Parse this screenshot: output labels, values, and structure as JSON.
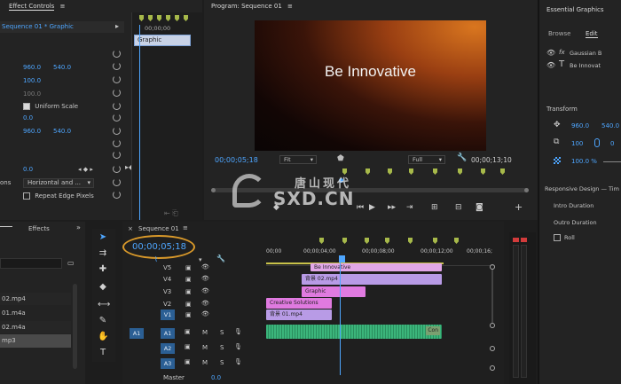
{
  "effect_controls": {
    "tab": "Effect Controls",
    "source": "Sequence 01 * Graphic",
    "clip_label": "Graphic",
    "timecode": "00;00;00",
    "pos_x": "960.0",
    "pos_y": "540.0",
    "scale": "100.0",
    "scale_width": "100.0",
    "uniform_scale": "Uniform Scale",
    "rotation": "0.0",
    "anchor_x": "960.0",
    "anchor_y": "540.0",
    "opacity": "0.0",
    "edge_label": "ons",
    "edge_value": "Horizontal and ...",
    "repeat_edge": "Repeat Edge Pixels"
  },
  "program": {
    "title": "Program: Sequence 01",
    "video_text": "Be Innovative",
    "timecode": "00;00;05;18",
    "fit": "Fit",
    "quality": "Full",
    "duration": "00;00;13;10"
  },
  "watermark": {
    "cn": "唐山现代",
    "domain": "SXD.CN"
  },
  "essential_graphics": {
    "title": "Essential Graphics",
    "tab_browse": "Browse",
    "tab_edit": "Edit",
    "layer1": "Gaussian B",
    "layer2": "Be Innovat",
    "transform": "Transform",
    "pos_x": "960.0",
    "pos_y": "540.0",
    "scale": "100",
    "rotation": "0",
    "opacity": "100.0 %",
    "responsive": "Responsive Design — Tim",
    "intro": "Intro Duration",
    "outro": "Outro Duration",
    "roll": "Roll"
  },
  "project": {
    "tab_effects": "Effects",
    "items": [
      "02.mp4",
      "01.m4a",
      "02.m4a",
      "mp3"
    ]
  },
  "timeline": {
    "tab": "Sequence 01",
    "timecode": "00;00;05;18",
    "ruler": [
      "00;00",
      "00;00;04;00",
      "00;00;08;00",
      "00;00;12;00",
      "00;00;16;"
    ],
    "tracks_video": [
      "V5",
      "V4",
      "V3",
      "V2",
      "V1"
    ],
    "tracks_audio": [
      "A1",
      "A2",
      "A3"
    ],
    "source_patch": "A1",
    "master": "Master",
    "master_value": "0.0",
    "clips": {
      "v5": "Be Innovative",
      "v4": "背景 02.mp4",
      "v3": "Graphic",
      "v2": "Creative Solutions",
      "v1": "背景 01.mp4",
      "a1": "Con"
    },
    "m": "M",
    "s": "S"
  },
  "colors": {
    "accent": "#4ea6ff",
    "clip_pink": "#e07ae0",
    "clip_violet": "#b89be6",
    "audio_green": "#3bb57b",
    "highlight_ring": "#d9992a"
  }
}
